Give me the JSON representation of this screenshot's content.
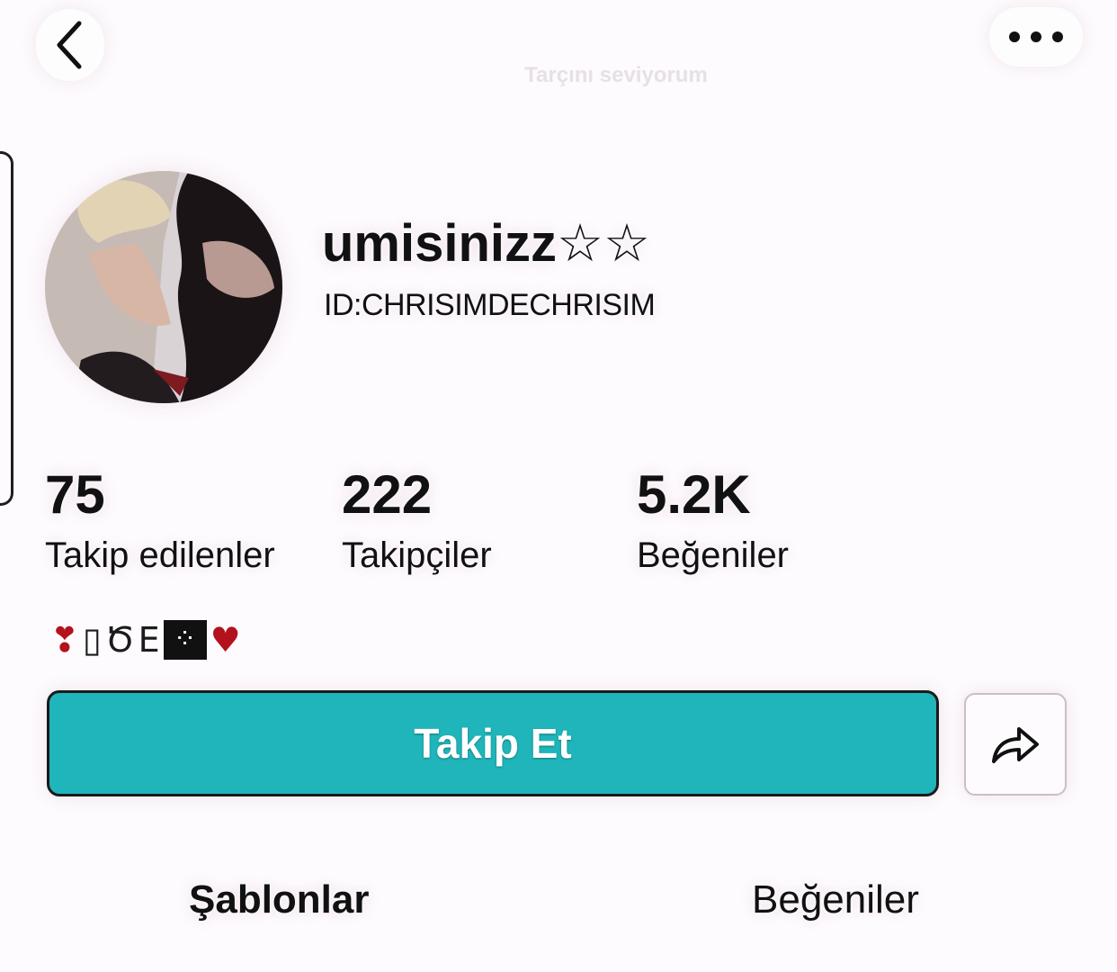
{
  "header": {
    "back_icon": "chevron-left-icon",
    "more_icon": "more-dots-icon",
    "watermark": "Tarçını seviyorum"
  },
  "profile": {
    "username": "umisinizz☆☆",
    "user_id": "ID:CHRISIMDECHRISIM",
    "bio_emojis": [
      "❣",
      "▯",
      "Ծ",
      "E",
      "⁘",
      "♥"
    ]
  },
  "stats": [
    {
      "value": "75",
      "label": "Takip edilenler"
    },
    {
      "value": "222",
      "label": "Takipçiler"
    },
    {
      "value": "5.2K",
      "label": "Beğeniler"
    }
  ],
  "actions": {
    "follow_label": "Takip Et",
    "follow_color": "#1fb5ba",
    "share_icon": "share-arrow-icon"
  },
  "tabs": [
    {
      "label": "Şablonlar",
      "active": true
    },
    {
      "label": "Beğeniler",
      "active": false
    }
  ]
}
